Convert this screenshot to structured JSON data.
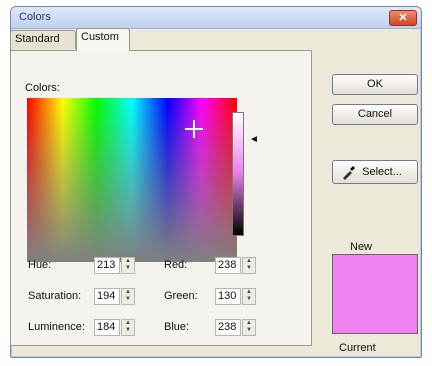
{
  "window": {
    "title": "Colors",
    "close_glyph": "✕"
  },
  "tabs": [
    {
      "label": "Standard",
      "selected": false
    },
    {
      "label": "Custom",
      "selected": true
    }
  ],
  "picker": {
    "colors_label": "Colors:",
    "luminance_indicator": "◄"
  },
  "fields": {
    "hue": {
      "label": "Hue:",
      "value": "213"
    },
    "saturation": {
      "label": "Saturation:",
      "value": "194"
    },
    "luminance": {
      "label": "Luminence:",
      "value": "184"
    },
    "red": {
      "label": "Red:",
      "value": "238"
    },
    "green": {
      "label": "Green:",
      "value": "130"
    },
    "blue": {
      "label": "Blue:",
      "value": "238"
    }
  },
  "buttons": {
    "ok": "OK",
    "cancel": "Cancel",
    "select": "Select..."
  },
  "preview": {
    "new_label": "New",
    "current_label": "Current",
    "color": "#ee82ee"
  },
  "icons": {
    "color_picker": "eyedropper-icon"
  },
  "colors": {
    "dialog_bg": "#ece9d8",
    "titlebar": "#bfd0ee",
    "close_button": "#d2452b",
    "selected_color": "#ee82ee"
  }
}
